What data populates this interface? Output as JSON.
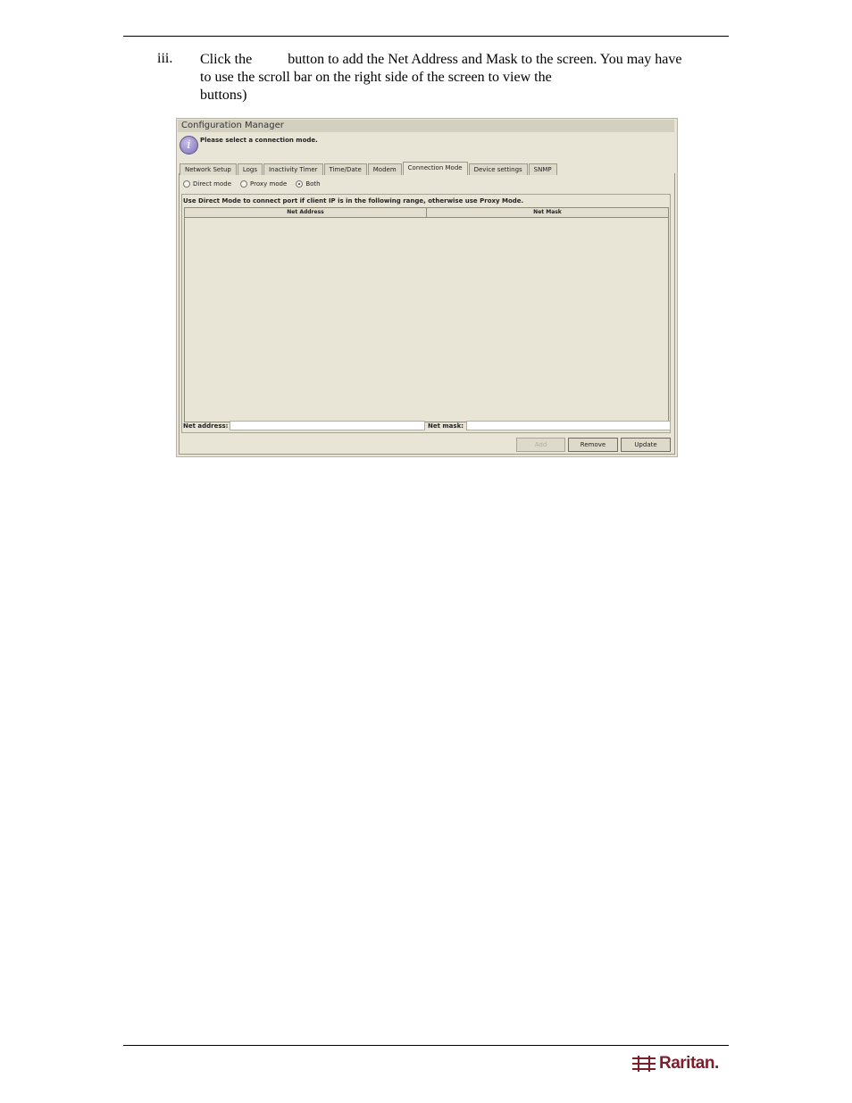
{
  "step": {
    "number": "iii.",
    "line1_a": "Click the",
    "line1_b": "button to add the Net Address and Mask to the screen. You may have",
    "line2": "to use the scroll bar on the right side of the screen to view the",
    "line3": "buttons)"
  },
  "screenshot": {
    "title": "Configuration Manager",
    "info_message": "Please select a connection mode.",
    "tabs": [
      "Network Setup",
      "Logs",
      "Inactivity Timer",
      "Time/Date",
      "Modem",
      "Connection Mode",
      "Device settings",
      "SNMP"
    ],
    "active_tab": "Connection Mode",
    "radios": [
      {
        "label": "Direct mode",
        "selected": false
      },
      {
        "label": "Proxy mode",
        "selected": false
      },
      {
        "label": "Both",
        "selected": true
      }
    ],
    "group_label": "Use Direct Mode to connect port if client IP is in the following range, otherwise use Proxy Mode.",
    "table_headers": [
      "Net Address",
      "Net Mask"
    ],
    "net_address_label": "Net address:",
    "net_address_value": "",
    "net_mask_label": "Net mask:",
    "net_mask_value": "",
    "buttons": {
      "add": "Add",
      "remove": "Remove",
      "update": "Update"
    }
  },
  "logo": {
    "text": "Raritan.",
    "brand_color": "#7d1f2b"
  }
}
